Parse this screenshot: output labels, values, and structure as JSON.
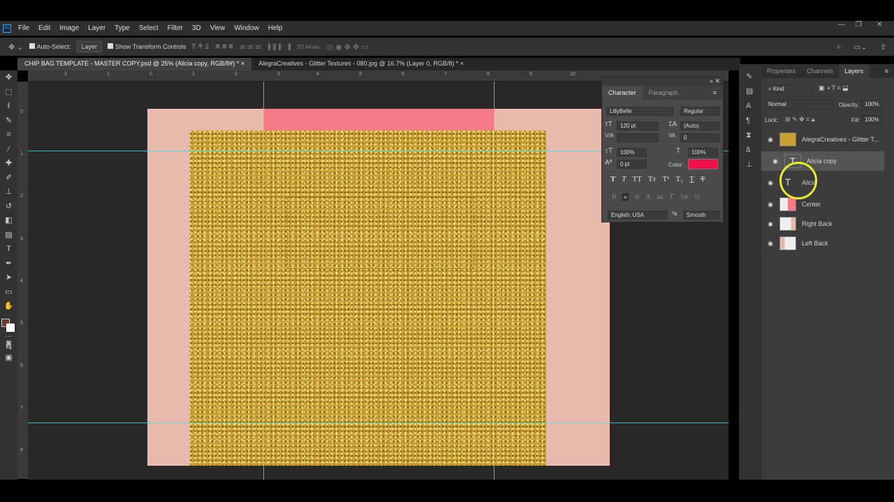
{
  "menu": {
    "logo": "Ps",
    "items": [
      "File",
      "Edit",
      "Image",
      "Layer",
      "Type",
      "Select",
      "Filter",
      "3D",
      "View",
      "Window",
      "Help"
    ]
  },
  "options": {
    "auto_select": "Auto-Select:",
    "layer_select": "Layer",
    "show_transform": "Show Transform Controls",
    "mode3d": "3D Mode:"
  },
  "tabs": [
    {
      "label": "CHIP BAG TEMPLATE - MASTER COPY.psd @ 25% (Alicia copy, RGB/8#) *"
    },
    {
      "label": "AlegraCreatives - Glitter Textures - 080.jpg @ 16.7% (Layer 0, RGB/8) *"
    }
  ],
  "ruler_top": [
    "2",
    "1",
    "0",
    "1",
    "2",
    "3",
    "4",
    "5",
    "6",
    "7",
    "8",
    "9",
    "10"
  ],
  "ruler_left": [
    "0",
    "1",
    "2",
    "3",
    "4",
    "5",
    "6",
    "7",
    "8"
  ],
  "character": {
    "tab_character": "Character",
    "tab_paragraph": "Paragraph",
    "font": "LillyBelle",
    "style": "Regular",
    "size": "120 pt",
    "leading": "(Auto)",
    "kerning": "",
    "tracking": "0",
    "vscale": "100%",
    "hscale": "100%",
    "baseline": "0 pt",
    "color_label": "Color:",
    "color": "#f0104a",
    "language": "English: USA",
    "antialias": "Smooth",
    "styles": [
      "T",
      "T",
      "TT",
      "Tт",
      "T¹",
      "T₁",
      "T",
      "T"
    ],
    "opentype": [
      "fi",
      "ℴ",
      "st",
      "A",
      "aa",
      "T",
      "1st",
      "½"
    ]
  },
  "layers": {
    "tabs": [
      "Properties",
      "Channels",
      "Layers"
    ],
    "kind": "Kind",
    "blend": "Normal",
    "opacity_label": "Opacity:",
    "opacity": "100%",
    "lock_label": "Lock:",
    "fill_label": "Fill:",
    "fill": "100%",
    "items": [
      {
        "name": "AlegraCreatives - Glitter T...",
        "type": "smart"
      },
      {
        "name": "Alicia copy",
        "type": "text",
        "selected": true
      },
      {
        "name": "Alicia",
        "type": "text"
      },
      {
        "name": "Center",
        "type": "smart"
      },
      {
        "name": "Right Back",
        "type": "smart"
      },
      {
        "name": "Left Back",
        "type": "smart"
      }
    ]
  }
}
